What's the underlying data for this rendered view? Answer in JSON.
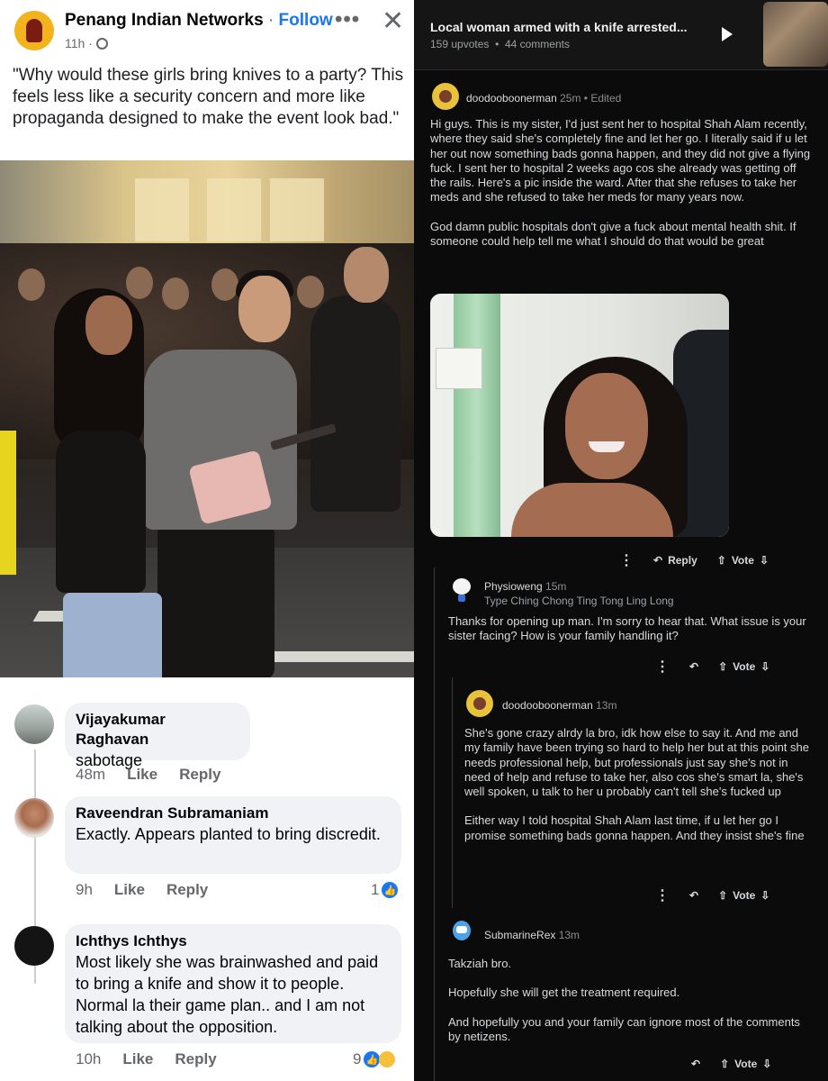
{
  "facebook": {
    "page_name": "Penang Indian Networks",
    "separator": " · ",
    "follow_label": "Follow",
    "post_time": "11h ·",
    "more_label": "•••",
    "close_label": "✕",
    "post_text": "\"Why would these girls bring knives to a party? This feels less like a security concern and more like propaganda designed to make the event look bad.\"",
    "comments": [
      {
        "name": "Vijayakumar Raghavan",
        "text": "sabotage",
        "time": "48m",
        "like": "Like",
        "reply": "Reply"
      },
      {
        "name": "Raveendran Subramaniam",
        "text": "Exactly. Appears planted to bring discredit.",
        "time": "9h",
        "like": "Like",
        "reply": "Reply",
        "reactions": "1"
      },
      {
        "name": "Ichthys Ichthys",
        "text": "Most likely she was brainwashed and paid to bring a knife and show it to people.  Normal la their game plan.. and I am not talking about the opposition.",
        "time": "10h",
        "like": "Like",
        "reply": "Reply",
        "reactions": "9"
      }
    ]
  },
  "reddit": {
    "title": "Local woman armed with a knife arrested...",
    "upvotes": "159 upvotes",
    "dot": "•",
    "comments_count": "44 comments",
    "post": {
      "user": "doodooboonerman",
      "meta": " 25m • Edited",
      "para1": "Hi guys. This is my sister, I'd just sent her to hospital Shah Alam recently, where they said she's completely fine and let her go. I literally said if u let her out now something bads gonna happen, and they did not give a flying fuck. I sent her to hospital 2 weeks ago cos she already was getting off the rails. Here's a pic inside the ward. After that she refuses to take her meds and she refused to take her meds for many years now.",
      "para2": "God damn public hospitals don't give a fuck about mental health shit. If someone could help tell me what I should do that would be great"
    },
    "reply_label": "Reply",
    "vote_label": "Vote",
    "more_label": "⋮",
    "comments": [
      {
        "user": "Physioweng",
        "meta": " 15m",
        "flair": "Type Ching Chong Ting Tong Ling Long",
        "text": "Thanks for opening up man. I'm sorry to hear that. What issue is your sister facing? How is your family handling it?"
      },
      {
        "user": "doodooboonerman",
        "meta": " 13m",
        "para1": "She's gone crazy alrdy la bro, idk how else to say it. And me and my family have been trying so hard to help her but at this point she needs professional help, but professionals just say she's not in need of help and refuse to take her, also cos she's smart la, she's well spoken, u talk to her u probably can't tell she's fucked up",
        "para2": "Either way I told hospital Shah Alam last time, if u let her go I promise something bads gonna happen. And they insist she's fine"
      },
      {
        "user": "SubmarineRex",
        "meta": " 13m",
        "para1": "Takziah bro.",
        "para2": "Hopefully she will get the treatment required.",
        "para3": "And hopefully you and your family can ignore most of the comments by netizens."
      }
    ]
  },
  "colors": {
    "facebook_blue": "#1877f2",
    "reddit_bg": "#0b0b0c",
    "bubble_bg": "#f0f2f5"
  },
  "icons": [
    "globe-icon",
    "more-icon",
    "close-icon",
    "like-reaction-icon",
    "haha-reaction-icon",
    "play-icon",
    "reply-icon",
    "upvote-icon",
    "downvote-icon",
    "kebab-icon"
  ]
}
